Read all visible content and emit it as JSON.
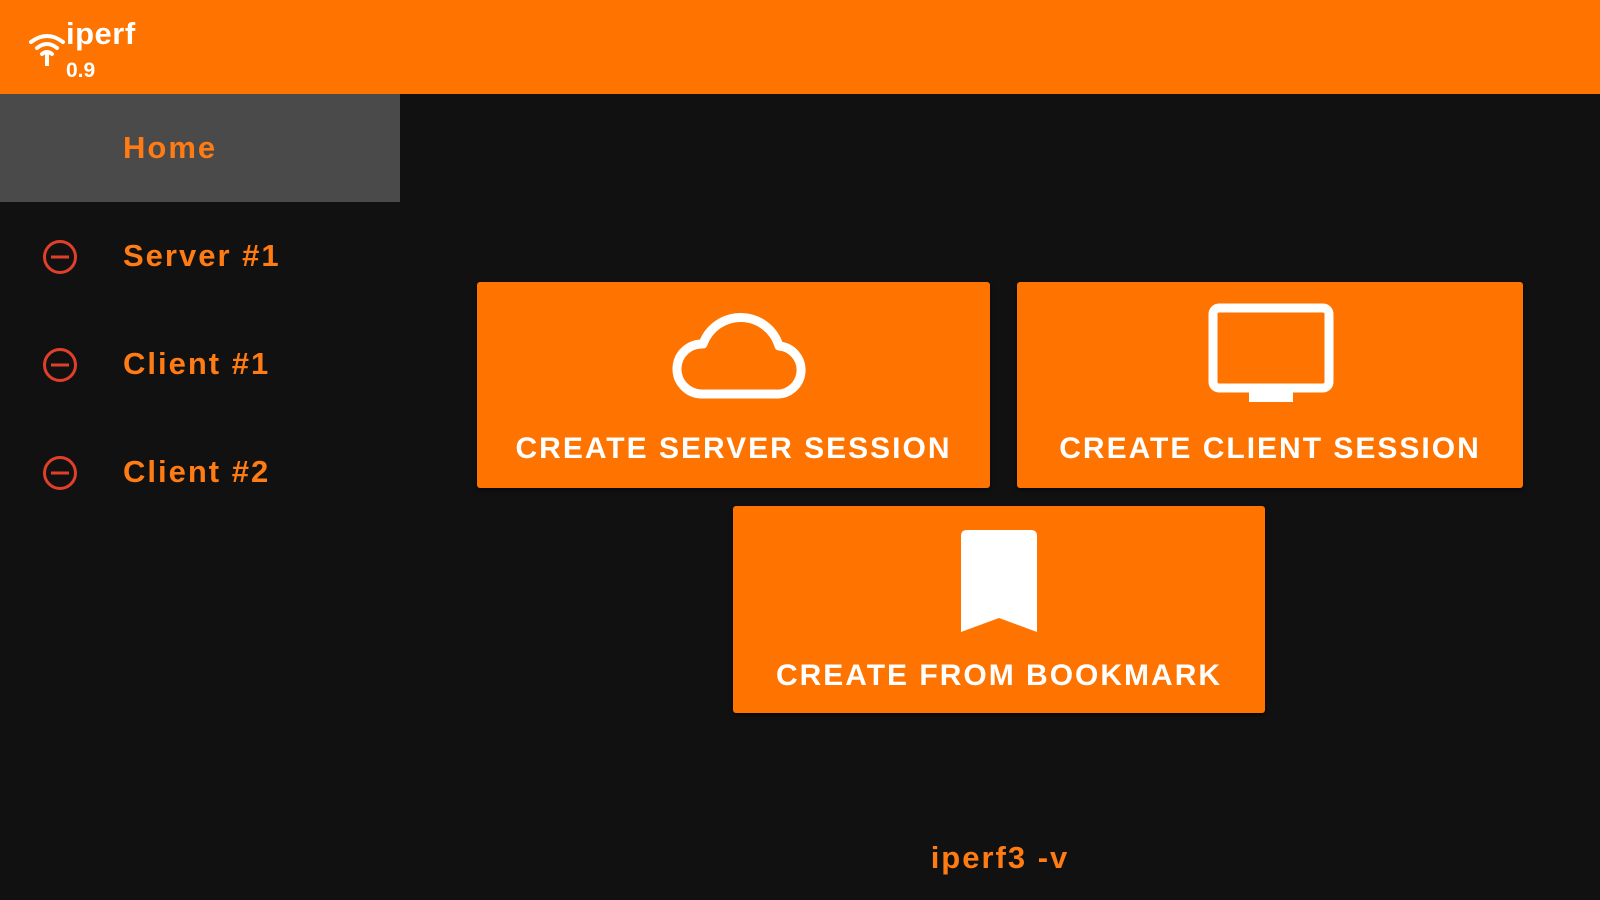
{
  "colors": {
    "accent": "#ff7300",
    "accent_text": "#ff7b14",
    "background": "#111111",
    "active_item": "#4a4a4a",
    "remove_icon": "#e0402a"
  },
  "header": {
    "app_name": "iperf",
    "version": "0.9",
    "logo_icon": "wifi-icon"
  },
  "sidebar": {
    "items": [
      {
        "label": "Home",
        "active": true,
        "icon": ""
      },
      {
        "label": "Server #1",
        "active": false,
        "icon": "remove-circle-icon"
      },
      {
        "label": "Client #1",
        "active": false,
        "icon": "remove-circle-icon"
      },
      {
        "label": "Client #2",
        "active": false,
        "icon": "remove-circle-icon"
      }
    ]
  },
  "main": {
    "actions": [
      {
        "label": "CREATE SERVER SESSION",
        "icon": "cloud-icon"
      },
      {
        "label": "CREATE CLIENT SESSION",
        "icon": "monitor-icon"
      },
      {
        "label": "CREATE FROM BOOKMARK",
        "icon": "bookmark-icon"
      }
    ],
    "version_command": "iperf3 -v"
  }
}
